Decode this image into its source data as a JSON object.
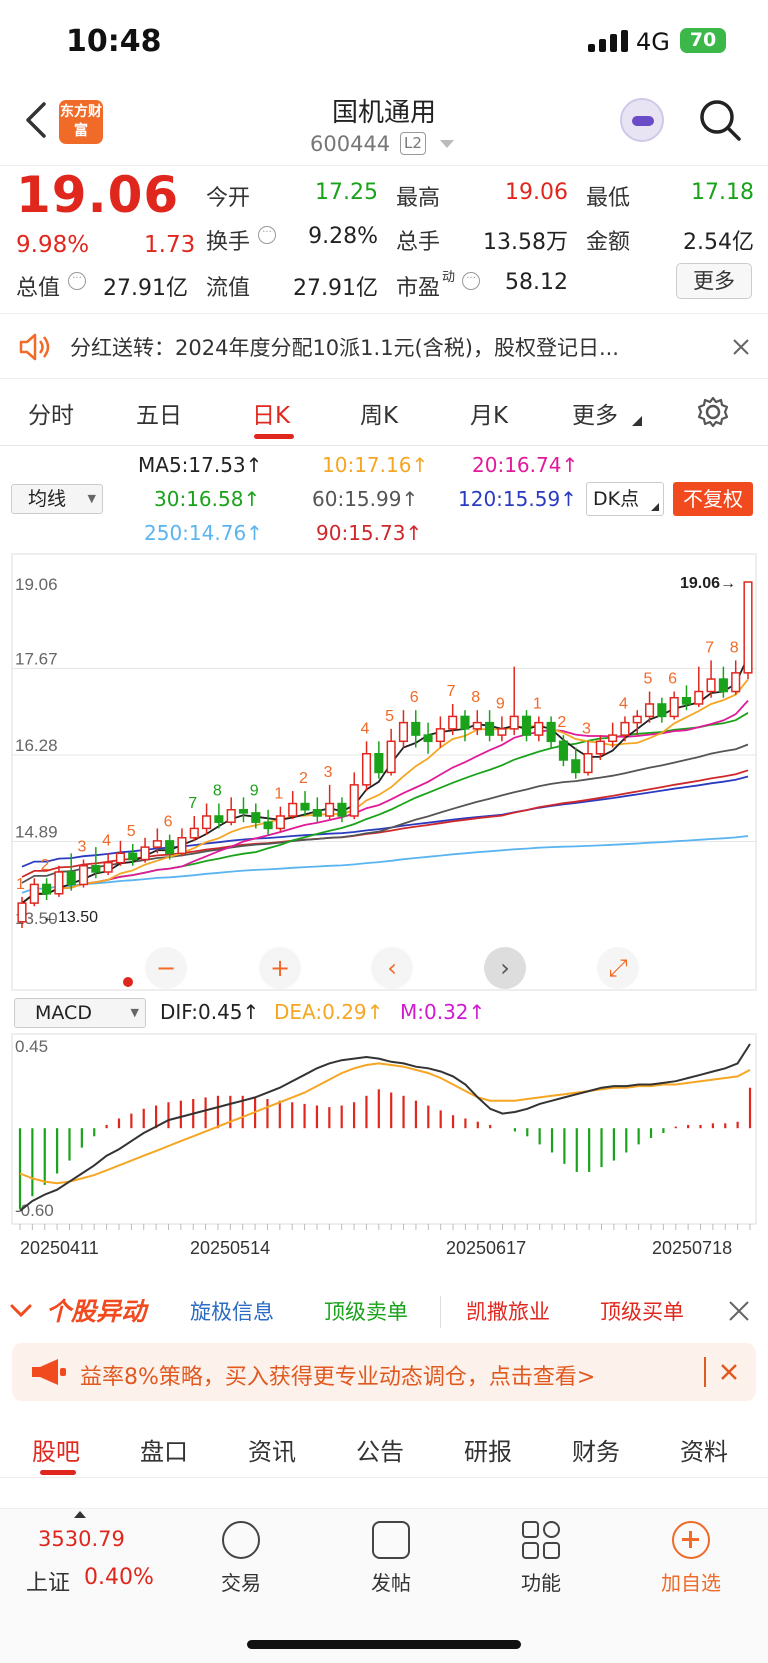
{
  "status_bar": {
    "time": "10:48",
    "network": "4G",
    "battery": "70"
  },
  "header": {
    "stock_name": "国机通用",
    "stock_code": "600444",
    "level_badge": "L2",
    "logo_text": "东方财富"
  },
  "quote": {
    "price": "19.06",
    "change_pct": "9.98%",
    "change_amt": "1.73",
    "fields": [
      {
        "label": "今开",
        "value": "17.25",
        "color": "green"
      },
      {
        "label": "最高",
        "value": "19.06",
        "color": "red"
      },
      {
        "label": "最低",
        "value": "17.18",
        "color": "green"
      },
      {
        "label": "换手",
        "value": "9.28%",
        "color": "normal"
      },
      {
        "label": "总手",
        "value": "13.58万",
        "color": "normal"
      },
      {
        "label": "金额",
        "value": "2.54亿",
        "color": "normal"
      },
      {
        "label": "总值",
        "value": "27.91亿",
        "color": "normal"
      },
      {
        "label": "流值",
        "value": "27.91亿",
        "color": "normal"
      },
      {
        "label": "市盈",
        "value": "58.12",
        "color": "normal"
      }
    ],
    "pe_superscript": "动",
    "more_label": "更多"
  },
  "notice": {
    "text": "分红送转：2024年度分配10派1.1元(含税)，股权登记日..."
  },
  "period_tabs": [
    "分时",
    "五日",
    "日K",
    "周K",
    "月K",
    "更多"
  ],
  "active_period": "日K",
  "indicator": {
    "ma_button": "均线",
    "dk_button": "DK点",
    "fuquan_button": "不复权",
    "ma": [
      {
        "label": "MA5:17.53↑",
        "color": "#222222"
      },
      {
        "label": "10:17.16↑",
        "color": "#f5a623"
      },
      {
        "label": "20:16.74↑",
        "color": "#e01a9a"
      },
      {
        "label": "30:16.58↑",
        "color": "#1aa31a"
      },
      {
        "label": "60:15.99↑",
        "color": "#555555"
      },
      {
        "label": "120:15.59↑",
        "color": "#2b3bc0"
      },
      {
        "label": "250:14.76↑",
        "color": "#5ab4f0"
      },
      {
        "label": "90:15.73↑",
        "color": "#d0282a"
      }
    ]
  },
  "chart_data": [
    {
      "type": "candlestick",
      "y_axis_labels": [
        "19.06",
        "17.67",
        "16.28",
        "14.89",
        "13.50"
      ],
      "ylim": [
        13.5,
        19.06
      ],
      "last_price_label": "19.06",
      "low_label": "13.50",
      "candles": [
        [
          13.6,
          13.9,
          13.5,
          14.0
        ],
        [
          13.9,
          14.2,
          13.85,
          14.3
        ],
        [
          14.2,
          14.05,
          13.95,
          14.3
        ],
        [
          14.05,
          14.4,
          14.0,
          14.5
        ],
        [
          14.4,
          14.2,
          14.1,
          14.7
        ],
        [
          14.2,
          14.5,
          14.15,
          14.6
        ],
        [
          14.5,
          14.4,
          14.3,
          14.8
        ],
        [
          14.4,
          14.55,
          14.35,
          14.7
        ],
        [
          14.55,
          14.7,
          14.5,
          14.9
        ],
        [
          14.7,
          14.6,
          14.5,
          14.85
        ],
        [
          14.6,
          14.8,
          14.55,
          14.95
        ],
        [
          14.8,
          14.9,
          14.7,
          15.1
        ],
        [
          14.9,
          14.7,
          14.6,
          15.0
        ],
        [
          14.7,
          14.95,
          14.65,
          15.1
        ],
        [
          14.95,
          15.1,
          14.9,
          15.3
        ],
        [
          15.1,
          15.3,
          15.0,
          15.5
        ],
        [
          15.3,
          15.2,
          15.1,
          15.5
        ],
        [
          15.2,
          15.4,
          15.15,
          15.6
        ],
        [
          15.4,
          15.35,
          15.2,
          15.6
        ],
        [
          15.35,
          15.2,
          15.1,
          15.5
        ],
        [
          15.2,
          15.1,
          15.0,
          15.4
        ],
        [
          15.1,
          15.3,
          15.05,
          15.45
        ],
        [
          15.3,
          15.5,
          15.25,
          15.7
        ],
        [
          15.5,
          15.4,
          15.3,
          15.7
        ],
        [
          15.4,
          15.3,
          15.2,
          15.6
        ],
        [
          15.3,
          15.5,
          15.25,
          15.8
        ],
        [
          15.5,
          15.3,
          15.2,
          15.6
        ],
        [
          15.3,
          15.8,
          15.25,
          16.0
        ],
        [
          15.8,
          16.3,
          15.7,
          16.5
        ],
        [
          16.3,
          16.0,
          15.9,
          16.5
        ],
        [
          16.0,
          16.5,
          15.95,
          16.7
        ],
        [
          16.5,
          16.8,
          16.4,
          17.0
        ],
        [
          16.8,
          16.6,
          16.4,
          17.0
        ],
        [
          16.6,
          16.5,
          16.3,
          16.8
        ],
        [
          16.5,
          16.7,
          16.4,
          16.9
        ],
        [
          16.7,
          16.9,
          16.6,
          17.1
        ],
        [
          16.9,
          16.7,
          16.5,
          17.0
        ],
        [
          16.7,
          16.8,
          16.6,
          17.0
        ],
        [
          16.8,
          16.6,
          16.5,
          17.0
        ],
        [
          16.6,
          16.7,
          16.5,
          16.9
        ],
        [
          16.7,
          16.9,
          16.6,
          17.7
        ],
        [
          16.9,
          16.6,
          16.5,
          17.0
        ],
        [
          16.6,
          16.8,
          16.5,
          16.9
        ],
        [
          16.8,
          16.5,
          16.4,
          16.9
        ],
        [
          16.5,
          16.2,
          16.1,
          16.6
        ],
        [
          16.2,
          16.0,
          15.9,
          16.4
        ],
        [
          16.0,
          16.3,
          15.95,
          16.5
        ],
        [
          16.3,
          16.5,
          16.2,
          16.6
        ],
        [
          16.5,
          16.6,
          16.4,
          16.8
        ],
        [
          16.6,
          16.8,
          16.5,
          16.9
        ],
        [
          16.8,
          16.9,
          16.6,
          17.0
        ],
        [
          16.9,
          17.1,
          16.8,
          17.3
        ],
        [
          17.1,
          16.9,
          16.8,
          17.2
        ],
        [
          16.9,
          17.2,
          16.85,
          17.3
        ],
        [
          17.2,
          17.1,
          17.0,
          17.4
        ],
        [
          17.1,
          17.3,
          17.05,
          17.7
        ],
        [
          17.3,
          17.5,
          17.2,
          17.8
        ],
        [
          17.5,
          17.3,
          17.2,
          17.7
        ],
        [
          17.3,
          17.6,
          17.25,
          17.8
        ],
        [
          17.6,
          19.06,
          17.5,
          19.06
        ]
      ],
      "ma_lines_note": "MA5, MA10, MA20, MA30, MA60, MA90, MA120, MA250 overlays",
      "signal_labels": [
        "1",
        "2",
        "3",
        "4",
        "5",
        "6",
        "7",
        "8",
        "9",
        "1",
        "2",
        "3",
        "4",
        "5",
        "6",
        "7",
        "8",
        "9",
        "1",
        "2",
        "3",
        "4",
        "5",
        "6",
        "7",
        "8"
      ],
      "controls": [
        "−",
        "+",
        "‹",
        "›",
        "⤢"
      ]
    },
    {
      "type": "macd",
      "title": "MACD",
      "dif_label": "DIF:0.45↑",
      "dea_label": "DEA:0.29↑",
      "m_label": "M:0.32↑",
      "y_axis_labels": [
        "0.45",
        "-0.60"
      ],
      "ylim": [
        -0.6,
        0.45
      ],
      "x_labels": [
        "20250411",
        "20250514",
        "20250617",
        "20250718"
      ],
      "histogram": [
        -0.5,
        -0.42,
        -0.35,
        -0.28,
        -0.2,
        -0.12,
        -0.05,
        0.02,
        0.06,
        0.09,
        0.12,
        0.14,
        0.16,
        0.17,
        0.18,
        0.19,
        0.2,
        0.2,
        0.2,
        0.19,
        0.18,
        0.17,
        0.16,
        0.15,
        0.14,
        0.13,
        0.14,
        0.16,
        0.2,
        0.24,
        0.22,
        0.2,
        0.17,
        0.14,
        0.11,
        0.08,
        0.06,
        0.04,
        0.02,
        0.0,
        -0.02,
        -0.05,
        -0.1,
        -0.15,
        -0.22,
        -0.27,
        -0.27,
        -0.24,
        -0.2,
        -0.15,
        -0.1,
        -0.06,
        -0.03,
        0.01,
        0.02,
        0.02,
        0.03,
        0.03,
        0.04,
        0.25
      ],
      "dif": [
        -0.58,
        -0.52,
        -0.48,
        -0.45,
        -0.4,
        -0.35,
        -0.3,
        -0.24,
        -0.2,
        -0.15,
        -0.1,
        -0.06,
        -0.02,
        0.0,
        0.02,
        0.04,
        0.06,
        0.08,
        0.1,
        0.12,
        0.15,
        0.18,
        0.22,
        0.26,
        0.3,
        0.33,
        0.35,
        0.36,
        0.37,
        0.36,
        0.34,
        0.33,
        0.31,
        0.3,
        0.28,
        0.25,
        0.2,
        0.12,
        0.05,
        0.02,
        0.03,
        0.05,
        0.08,
        0.1,
        0.12,
        0.14,
        0.16,
        0.18,
        0.19,
        0.19,
        0.2,
        0.2,
        0.21,
        0.22,
        0.24,
        0.26,
        0.28,
        0.3,
        0.33,
        0.45
      ],
      "dea": [
        -0.35,
        -0.38,
        -0.4,
        -0.41,
        -0.4,
        -0.38,
        -0.36,
        -0.33,
        -0.3,
        -0.27,
        -0.24,
        -0.21,
        -0.18,
        -0.15,
        -0.12,
        -0.09,
        -0.06,
        -0.03,
        0.0,
        0.03,
        0.06,
        0.09,
        0.12,
        0.15,
        0.19,
        0.23,
        0.27,
        0.3,
        0.32,
        0.33,
        0.32,
        0.31,
        0.29,
        0.27,
        0.24,
        0.2,
        0.16,
        0.12,
        0.1,
        0.1,
        0.1,
        0.11,
        0.12,
        0.13,
        0.14,
        0.15,
        0.16,
        0.17,
        0.18,
        0.18,
        0.19,
        0.19,
        0.2,
        0.2,
        0.21,
        0.22,
        0.23,
        0.24,
        0.25,
        0.29
      ]
    }
  ],
  "yidong": {
    "title": "个股异动",
    "tabs": [
      {
        "label": "旋极信息",
        "color": "#2b6cc4"
      },
      {
        "label": "顶级卖单",
        "color": "#1aa31a"
      },
      {
        "label": "凯撒旅业",
        "color": "#e0271e"
      },
      {
        "label": "顶级买单",
        "color": "#e0271e"
      }
    ]
  },
  "promo": {
    "text": "益率8%策略，买入获得更专业动态调仓，点击查看>"
  },
  "bottom_tabs": [
    "股吧",
    "盘口",
    "资讯",
    "公告",
    "研报",
    "财务",
    "资料"
  ],
  "active_bottom_tab": "股吧",
  "tab_bar": {
    "index_value": "3530.79",
    "index_name": "上证",
    "index_change": "0.40%",
    "items": [
      {
        "label": "交易",
        "icon": "trade-icon"
      },
      {
        "label": "发帖",
        "icon": "post-icon"
      },
      {
        "label": "功能",
        "icon": "function-icon"
      },
      {
        "label": "加自选",
        "icon": "add-watchlist-icon"
      }
    ]
  },
  "colors": {
    "up": "#e0271e",
    "down": "#1aa31a",
    "accent": "#f06a28"
  }
}
